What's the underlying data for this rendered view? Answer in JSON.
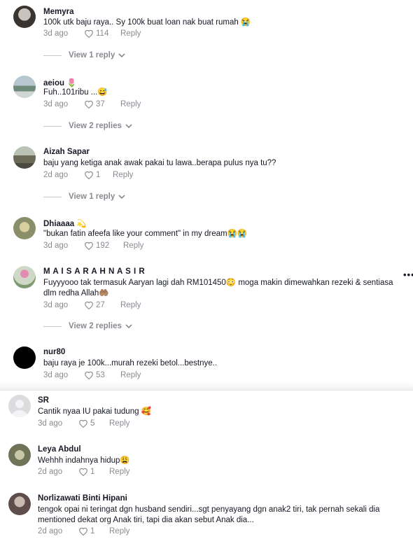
{
  "comments": [
    {
      "name": "Memyra",
      "text": "100k utk baju raya.. Sy 100k buat loan nak buat rumah 😭",
      "date": "3d ago",
      "likes": "114",
      "reply": "Reply",
      "view_replies": "View 1 reply"
    },
    {
      "name": "aeiou 🌷",
      "text": "Fuh..101ribu ...😅",
      "date": "3d ago",
      "likes": "37",
      "reply": "Reply",
      "view_replies": "View 2 replies"
    },
    {
      "name": "Aizah Sapar",
      "text": "baju yang ketiga anak awak pakai tu lawa..berapa pulus nya tu??",
      "date": "2d ago",
      "likes": "1",
      "reply": "Reply",
      "view_replies": "View 1 reply"
    },
    {
      "name": "Dhiaaaa 💫",
      "text": "\"bukan fatin afeefa like your comment\" in my dream😭😭",
      "date": "3d ago",
      "likes": "192",
      "reply": "Reply"
    },
    {
      "name": "M A I S A R A H N A S I R",
      "text": "Fuyyyooo tak termasuk Aaryan lagi dah RM101450😳 moga makin dimewahkan rezeki & sentiasa dlm redha Allah🤲🏽",
      "date": "3d ago",
      "likes": "27",
      "reply": "Reply",
      "view_replies": "View 2 replies"
    },
    {
      "name": "nur80",
      "text": "baju raya je 100k...murah rezeki betol...bestnye..",
      "date": "3d ago",
      "likes": "53",
      "reply": "Reply"
    },
    {
      "name": "SR",
      "text": "Cantik nyaa IU pakai tudung 🥰",
      "date": "3d ago",
      "likes": "5",
      "reply": "Reply"
    },
    {
      "name": "Leya Abdul",
      "text": "Wehhh indahnya hidup😩",
      "date": "2d ago",
      "likes": "1",
      "reply": "Reply"
    },
    {
      "name": "Norlizawati Binti Hipani",
      "text": "tengok opai ni teringat dgn husband sendiri...sgt penyayang dgn anak2 tiri, tak pernah sekali dia mentioned dekat org Anak tiri, tapi dia akan sebut Anak dia...",
      "date": "2d ago",
      "likes": "1",
      "reply": "Reply"
    }
  ],
  "more_options": "•••",
  "icons": {
    "like": "heart-outline-icon",
    "expand": "chevron-down-icon"
  },
  "colors": {
    "text": "#161823",
    "muted": "#8a8b91"
  }
}
